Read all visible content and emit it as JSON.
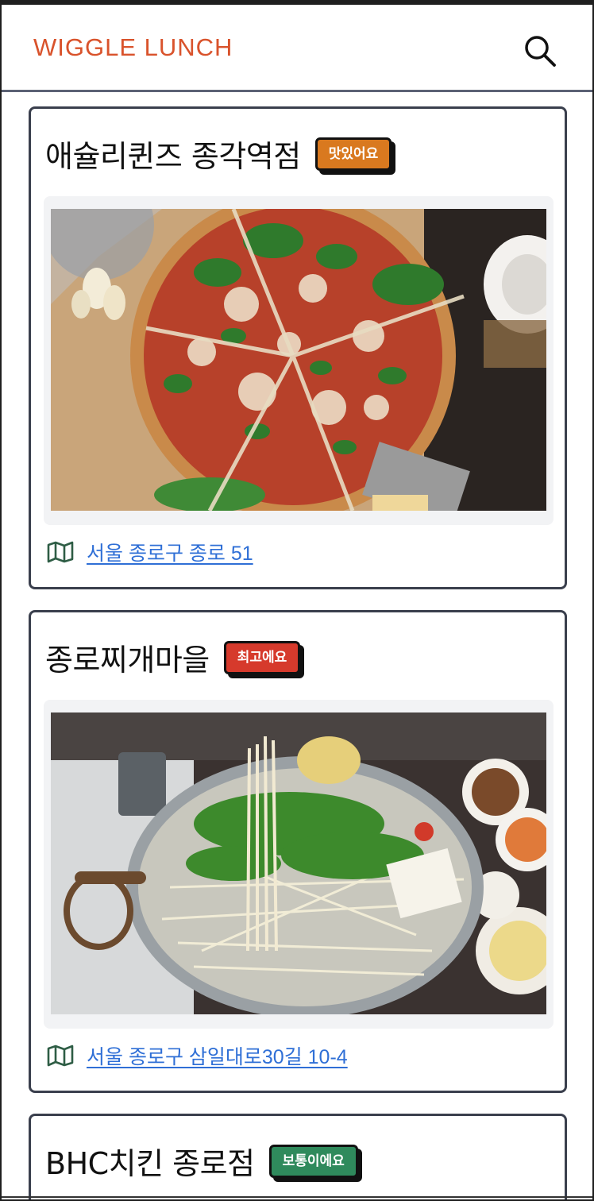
{
  "app": {
    "title": "WIGGLE LUNCH"
  },
  "header": {
    "search_icon": "search-icon"
  },
  "restaurants": [
    {
      "name": "애슐리퀸즈 종각역점",
      "rating": "맛있어요",
      "rating_color": "#d9791f",
      "photo": "pizza-photo",
      "address": "서울 종로구 종로 51"
    },
    {
      "name": "종로찌개마을",
      "rating": "최고에요",
      "rating_color": "#d63a2c",
      "photo": "hotpot-photo",
      "address": "서울 종로구 삼일대로30길 10-4"
    },
    {
      "name": "BHC치킨 종로점",
      "rating": "보통이에요",
      "rating_color": "#2f8a5c"
    }
  ]
}
